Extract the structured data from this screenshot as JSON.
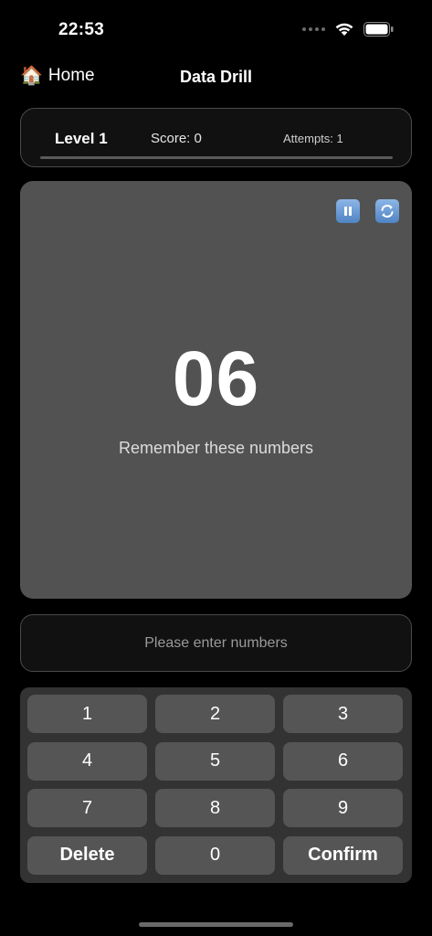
{
  "status_bar": {
    "time": "22:53"
  },
  "nav": {
    "home_icon": "🏠",
    "home_label": "Home",
    "title": "Data Drill"
  },
  "stats": {
    "level": "Level 1",
    "score": "Score: 0",
    "attempts": "Attempts: 1"
  },
  "memory": {
    "number": "06",
    "instruction": "Remember these numbers",
    "controls": {
      "pause_icon": "pause-icon",
      "refresh_icon": "refresh-icon",
      "accent": "#5b8fd0"
    }
  },
  "input": {
    "placeholder": "Please enter numbers"
  },
  "keypad": {
    "keys": [
      "1",
      "2",
      "3",
      "4",
      "5",
      "6",
      "7",
      "8",
      "9",
      "Delete",
      "0",
      "Confirm"
    ]
  },
  "colors": {
    "background": "#000000",
    "card": "#525252",
    "keypad": "#333333",
    "key": "#555555"
  }
}
